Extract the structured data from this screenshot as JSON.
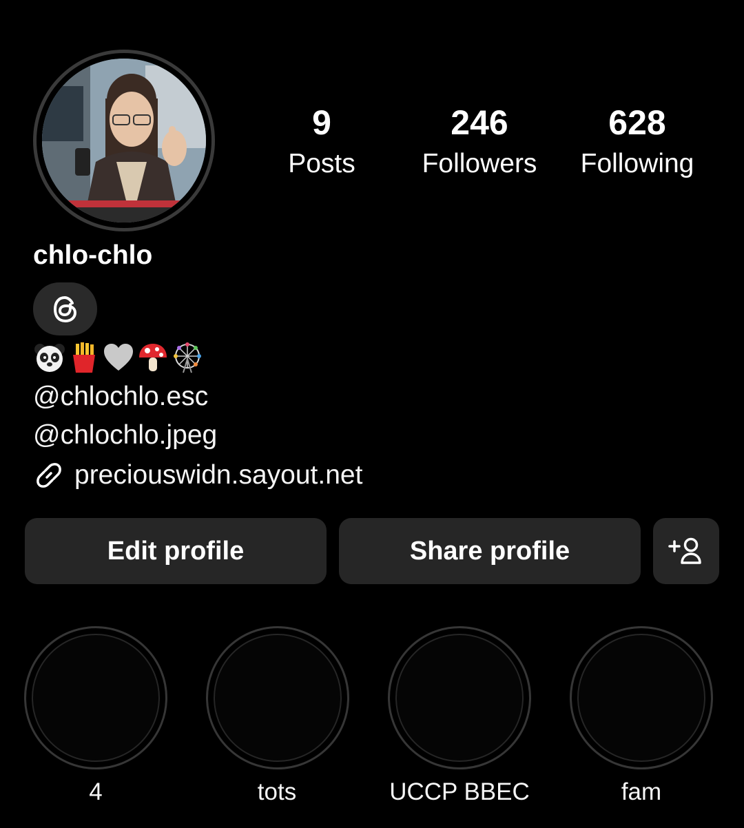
{
  "profile": {
    "username": "chlo-chlo",
    "stats": {
      "posts_count": "9",
      "posts_label": "Posts",
      "followers_count": "246",
      "followers_label": "Followers",
      "following_count": "628",
      "following_label": "Following"
    },
    "threads_icon": "threads-icon",
    "bio": {
      "emoji": [
        "🐼",
        "🍟",
        "🩶",
        "🍄",
        "🎡"
      ],
      "line_1": "@chlochlo.esc",
      "line_2": "@chlochlo.jpeg",
      "link_icon": "link-icon",
      "link": "preciouswidn.sayout.net"
    }
  },
  "actions": {
    "edit_label": "Edit profile",
    "share_label": "Share profile",
    "add_icon": "add-person-icon"
  },
  "highlights": [
    {
      "label": "4"
    },
    {
      "label": "tots"
    },
    {
      "label": "UCCP BBEC"
    },
    {
      "label": "fam"
    }
  ],
  "colors": {
    "background": "#000000",
    "button_bg": "#262626",
    "ring": "#3a3a3a",
    "text": "#ffffff"
  }
}
